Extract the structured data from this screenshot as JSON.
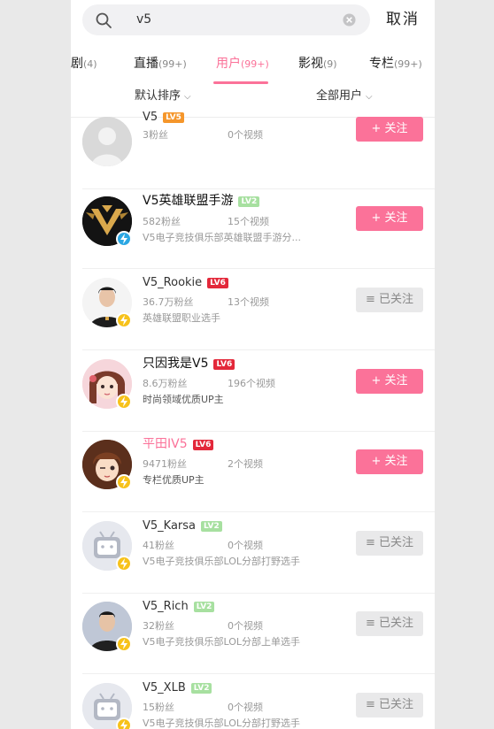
{
  "search": {
    "query": "v5",
    "cancel_label": "取消"
  },
  "tabs": [
    {
      "label": "番剧",
      "count": "(4)",
      "active": false
    },
    {
      "label": "直播",
      "count": "(99+)",
      "active": false
    },
    {
      "label": "用户",
      "count": "(99+)",
      "active": true
    },
    {
      "label": "影视",
      "count": "(9)",
      "active": false
    },
    {
      "label": "专栏",
      "count": "(99+)",
      "active": false
    }
  ],
  "sort": {
    "default_sort": "默认排序",
    "all_users": "全部用户"
  },
  "colors": {
    "accent": "#fb7299",
    "verified_blue": "#2ba7e3",
    "verified_yellow": "#f7c21b"
  },
  "users": [
    {
      "name": "V5",
      "level": "LV5",
      "fans": "3粉丝",
      "videos": "0个视频",
      "desc": "",
      "follow": "+ 关注",
      "followed": false,
      "avatar_icon": "default-person-avatar-icon",
      "badge": ""
    },
    {
      "name": "V5英雄联盟手游",
      "level": "LV2",
      "fans": "582粉丝",
      "videos": "15个视频",
      "desc": "V5电子竞技俱乐部英雄联盟手游分...",
      "follow": "+ 关注",
      "followed": false,
      "avatar_icon": "v5-logo-avatar-icon",
      "badge": "blue"
    },
    {
      "name": "V5_Rookie",
      "level": "LV6",
      "fans": "36.7万粉丝",
      "videos": "13个视频",
      "desc": "英雄联盟职业选手",
      "follow": "≡ 已关注",
      "followed": true,
      "avatar_icon": "player-photo-avatar-icon",
      "badge": "yellow"
    },
    {
      "name": "只因我是V5",
      "level": "LV6",
      "fans": "8.6万粉丝",
      "videos": "196个视频",
      "desc": "时尚领域优质UP主",
      "follow": "+ 关注",
      "followed": false,
      "avatar_icon": "anime-girl-avatar-icon",
      "badge": "yellow"
    },
    {
      "name": "平田IV5",
      "level": "LV6",
      "fans": "9471粉丝",
      "videos": "2个视频",
      "desc": "专栏优质UP主",
      "follow": "+ 关注",
      "followed": false,
      "avatar_icon": "anime-wink-avatar-icon",
      "badge": "yellow"
    },
    {
      "name": "V5_Karsa",
      "level": "LV2",
      "fans": "41粉丝",
      "videos": "0个视频",
      "desc": "V5电子竞技俱乐部LOL分部打野选手",
      "follow": "≡ 已关注",
      "followed": true,
      "avatar_icon": "tv-mascot-avatar-icon",
      "badge": "yellow"
    },
    {
      "name": "V5_Rich",
      "level": "LV2",
      "fans": "32粉丝",
      "videos": "0个视频",
      "desc": "V5电子竞技俱乐部LOL分部上单选手",
      "follow": "≡ 已关注",
      "followed": true,
      "avatar_icon": "player-photo-avatar-icon",
      "badge": "yellow"
    },
    {
      "name": "V5_XLB",
      "level": "LV2",
      "fans": "15粉丝",
      "videos": "0个视频",
      "desc": "V5电子竞技俱乐部LOL分部打野选手",
      "follow": "≡ 已关注",
      "followed": true,
      "avatar_icon": "tv-mascot-avatar-icon",
      "badge": "yellow"
    }
  ]
}
